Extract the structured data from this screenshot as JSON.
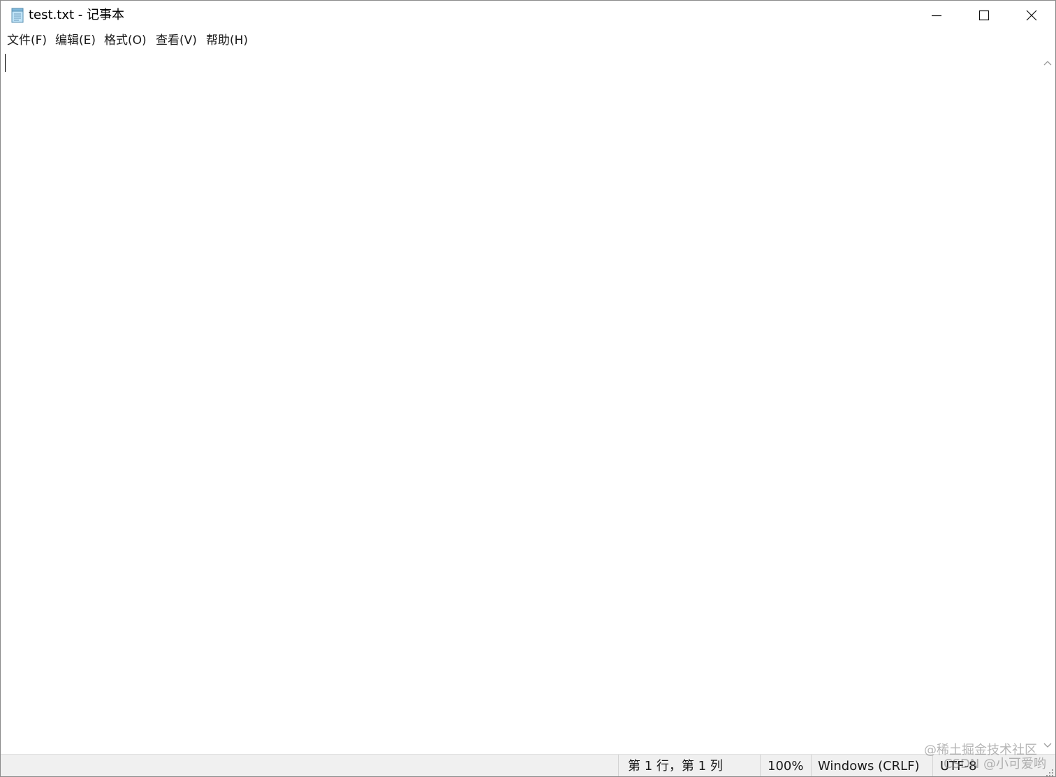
{
  "window": {
    "title": "test.txt - 记事本",
    "icon": "notepad-icon",
    "controls": {
      "minimize": "minimize-icon",
      "maximize": "maximize-icon",
      "close": "close-icon"
    }
  },
  "menu": {
    "items": [
      {
        "label": "文件(F)"
      },
      {
        "label": "编辑(E)"
      },
      {
        "label": "格式(O)"
      },
      {
        "label": "查看(V)"
      },
      {
        "label": "帮助(H)"
      }
    ]
  },
  "editor": {
    "content": ""
  },
  "status": {
    "position": "第 1 行，第 1 列",
    "zoom": "100%",
    "line_ending": "Windows (CRLF)",
    "encoding": "UTF-8"
  },
  "watermark": {
    "line1": "@稀土掘金技术社区",
    "line2": "CSDN @小可爱哟"
  },
  "colors": {
    "statusbar_bg": "#f0f0f0",
    "window_bg": "#ffffff",
    "text": "#1a1a1a"
  }
}
